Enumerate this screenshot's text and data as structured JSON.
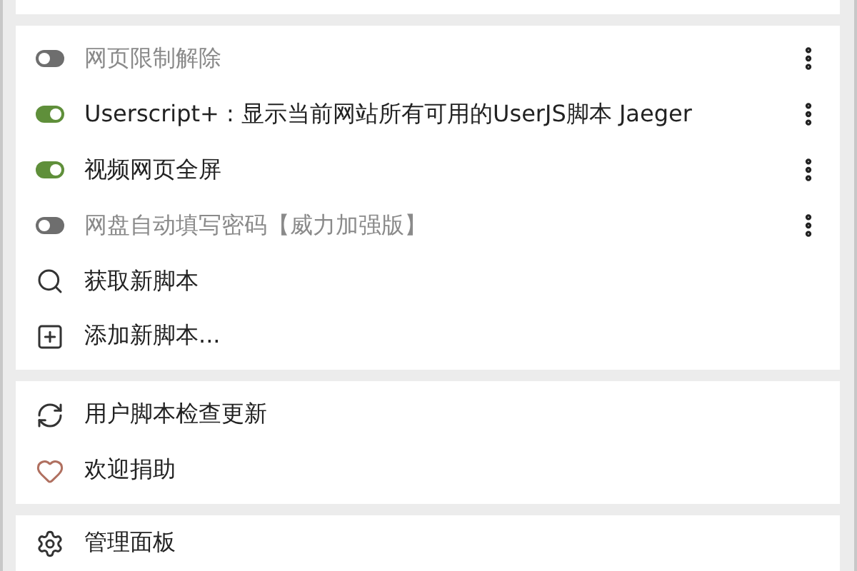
{
  "scripts": [
    {
      "name": "网页限制解除",
      "enabled": false
    },
    {
      "name": "Userscript+ : 显示当前网站所有可用的UserJS脚本 Jaeger",
      "enabled": true
    },
    {
      "name": "视频网页全屏",
      "enabled": true
    },
    {
      "name": "网盘自动填写密码【威力加强版】",
      "enabled": false
    }
  ],
  "script_actions": [
    {
      "kind": "search",
      "label": "获取新脚本"
    },
    {
      "kind": "add",
      "label": "添加新脚本..."
    }
  ],
  "support_actions": [
    {
      "kind": "refresh",
      "label": "用户脚本检查更新"
    },
    {
      "kind": "heart",
      "label": "欢迎捐助"
    }
  ],
  "admin_actions": [
    {
      "kind": "gear",
      "label": "管理面板"
    }
  ]
}
